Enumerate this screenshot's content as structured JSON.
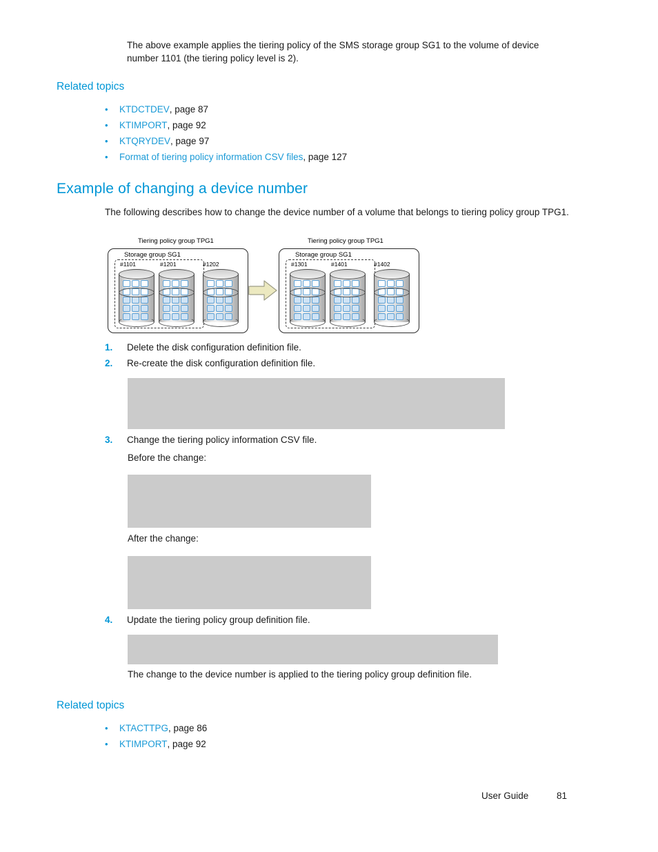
{
  "intro": {
    "paragraph": "The above example applies the tiering policy of the SMS storage group SG1 to the volume of device number 1101 (the tiering policy level is 2)."
  },
  "related_topics_top": {
    "heading": "Related topics",
    "bullet": "•",
    "items": [
      {
        "link": "KTDCTDEV",
        "rest": ", page 87"
      },
      {
        "link": "KTIMPORT",
        "rest": ", page 92"
      },
      {
        "link": "KTQRYDEV",
        "rest": ", page 97"
      },
      {
        "link": "Format of tiering policy information CSV files",
        "rest": ", page 127"
      }
    ]
  },
  "section": {
    "heading": "Example of changing a device number",
    "paragraph": "The following describes how to change the device number of a volume that belongs to tiering policy group TPG1."
  },
  "figure": {
    "left_group": {
      "tpg_label": "Tiering policy group TPG1",
      "sg_label": "Storage group SG1",
      "devices": [
        "#1101",
        "#1201",
        "#1202"
      ]
    },
    "arrow": "right-arrow-icon",
    "right_group": {
      "tpg_label": "Tiering policy group TPG1",
      "sg_label": "Storage group SG1",
      "devices": [
        "#1301",
        "#1401",
        "#1402"
      ]
    }
  },
  "steps": [
    {
      "num": "1.",
      "text": "Delete the disk configuration definition file."
    },
    {
      "num": "2.",
      "text": "Re-create the disk configuration definition file."
    },
    {
      "num": "3.",
      "text": "Change the tiering policy information CSV file."
    },
    {
      "num": "4.",
      "text": "Update the tiering policy group definition file."
    }
  ],
  "labels": {
    "before_change": "Before the change:",
    "after_change": "After the change:",
    "result": "The change to the device number is applied to the tiering policy group definition file."
  },
  "related_topics_bottom": {
    "heading": "Related topics",
    "bullet": "•",
    "items": [
      {
        "link": "KTACTTPG",
        "rest": ", page 86"
      },
      {
        "link": "KTIMPORT",
        "rest": ", page 92"
      }
    ]
  },
  "footer": {
    "doc_title": "User Guide",
    "page_number": "81"
  },
  "colors": {
    "accent_blue": "#0096d6",
    "link_blue": "#1a9ad7",
    "code_block_gray": "#cbcbcb",
    "arrow_fill": "#ece9c0",
    "cell_blue": "#cfe3f5"
  }
}
